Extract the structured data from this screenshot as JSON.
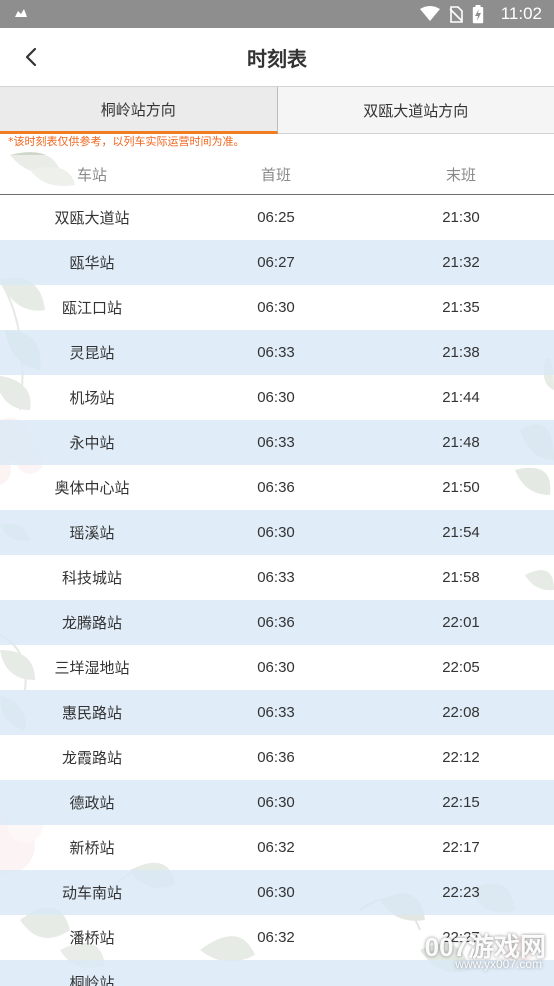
{
  "status_bar": {
    "time": "11:02",
    "icons": [
      "notification-icon",
      "wifi-icon",
      "no-sim-icon",
      "battery-charging-icon"
    ]
  },
  "header": {
    "title": "时刻表",
    "back_icon": "chevron-left-icon"
  },
  "tabs": [
    {
      "label": "桐岭站方向",
      "active": true
    },
    {
      "label": "双瓯大道站方向",
      "active": false
    }
  ],
  "notice": "*该时刻表仅供参考，以列车实际运营时间为准。",
  "table": {
    "columns": [
      "车站",
      "首班",
      "末班"
    ],
    "rows": [
      {
        "station": "双瓯大道站",
        "first": "06:25",
        "last": "21:30"
      },
      {
        "station": "瓯华站",
        "first": "06:27",
        "last": "21:32"
      },
      {
        "station": "瓯江口站",
        "first": "06:30",
        "last": "21:35"
      },
      {
        "station": "灵昆站",
        "first": "06:33",
        "last": "21:38"
      },
      {
        "station": "机场站",
        "first": "06:30",
        "last": "21:44"
      },
      {
        "station": "永中站",
        "first": "06:33",
        "last": "21:48"
      },
      {
        "station": "奥体中心站",
        "first": "06:36",
        "last": "21:50"
      },
      {
        "station": "瑶溪站",
        "first": "06:30",
        "last": "21:54"
      },
      {
        "station": "科技城站",
        "first": "06:33",
        "last": "21:58"
      },
      {
        "station": "龙腾路站",
        "first": "06:36",
        "last": "22:01"
      },
      {
        "station": "三垟湿地站",
        "first": "06:30",
        "last": "22:05"
      },
      {
        "station": "惠民路站",
        "first": "06:33",
        "last": "22:08"
      },
      {
        "station": "龙霞路站",
        "first": "06:36",
        "last": "22:12"
      },
      {
        "station": "德政站",
        "first": "06:30",
        "last": "22:15"
      },
      {
        "station": "新桥站",
        "first": "06:32",
        "last": "22:17"
      },
      {
        "station": "动车南站",
        "first": "06:30",
        "last": "22:23"
      },
      {
        "station": "潘桥站",
        "first": "06:32",
        "last": "22:27"
      },
      {
        "station": "桐岭站",
        "first": "",
        "last": ""
      }
    ]
  },
  "watermark": {
    "main": "007游戏网",
    "url": "www.yx007.com"
  },
  "colors": {
    "accent": "#f07d20",
    "notice": "#f0661e",
    "row_alt": "#ddecf7",
    "status_bar": "#8e8e8e"
  }
}
